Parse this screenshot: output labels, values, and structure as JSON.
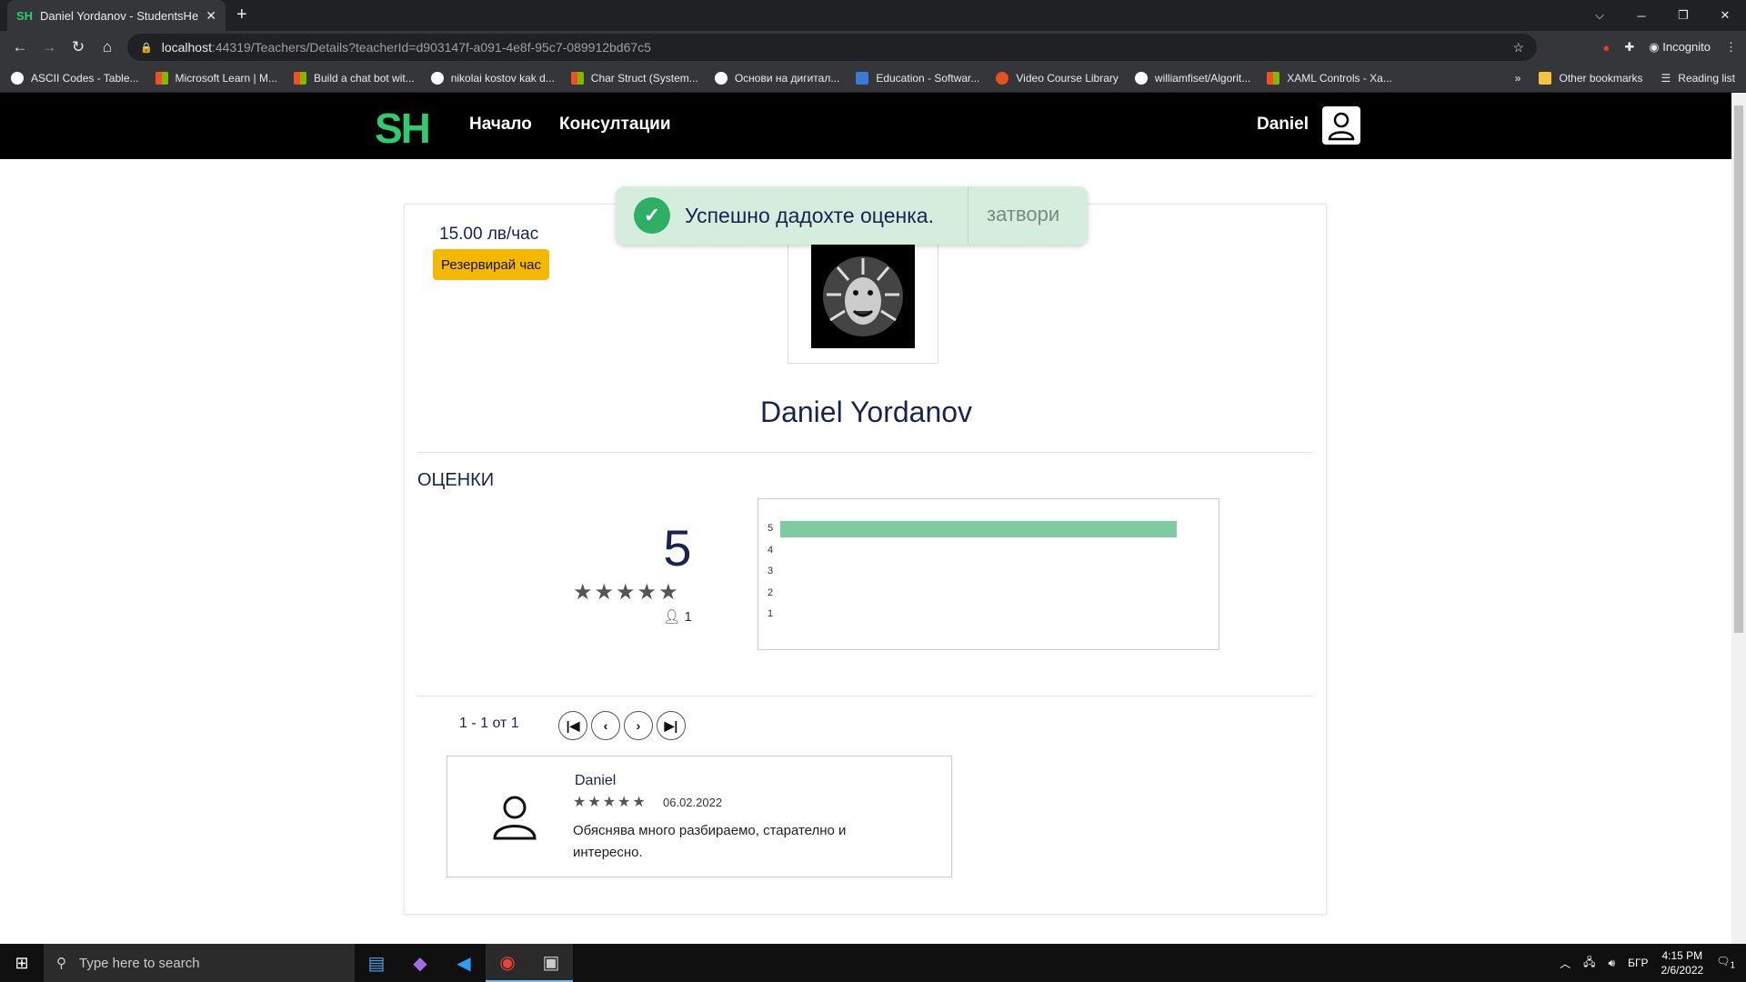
{
  "browser": {
    "tab_title": "Daniel Yordanov - StudentsHelpe",
    "tab_favicon": "SH",
    "url_host": "localhost",
    "url_rest": ":44319/Teachers/Details?teacherId=d903147f-a091-4e8f-95c7-089912bd67c5",
    "profile": "Incognito",
    "bookmarks": [
      {
        "label": "ASCII Codes - Table...",
        "color": "#ffffff"
      },
      {
        "label": "Microsoft Learn | M...",
        "color": "#f25022"
      },
      {
        "label": "Build a chat bot wit...",
        "color": "#f25022"
      },
      {
        "label": "nikolai kostov kak d...",
        "color": "#ffffff"
      },
      {
        "label": "Char Struct (System...",
        "color": "#f25022"
      },
      {
        "label": "Основи на дигитал...",
        "color": "#ffffff"
      },
      {
        "label": "Education - Softwar...",
        "color": "#3a7bd5"
      },
      {
        "label": "Video Course Library",
        "color": "#e8501c"
      },
      {
        "label": "williamfiset/Algorit...",
        "color": "#ffffff"
      },
      {
        "label": "XAML Controls - Xa...",
        "color": "#f25022"
      }
    ],
    "other_bookmarks": "Other bookmarks",
    "reading_list": "Reading list",
    "more": "»"
  },
  "site": {
    "logo": "SH",
    "nav": [
      "Начало",
      "Консултации"
    ],
    "user": "Daniel"
  },
  "toast": {
    "message": "Успешно дадохте оценка.",
    "close": "затвори"
  },
  "teacher": {
    "price": "15.00 лв/час",
    "reserve": "Резервирай час",
    "name": "Daniel Yordanov"
  },
  "ratings": {
    "label": "ОЦЕНКИ",
    "average": "5",
    "stars": 5,
    "count": "1"
  },
  "chart_data": {
    "type": "bar",
    "orientation": "horizontal",
    "categories": [
      "5",
      "4",
      "3",
      "2",
      "1"
    ],
    "values": [
      1,
      0,
      0,
      0,
      0
    ],
    "color": "#7ecba1"
  },
  "pagination": {
    "text": "1 - 1 от 1"
  },
  "reviews": [
    {
      "user": "Daniel",
      "stars": 5,
      "date": "06.02.2022",
      "text": "Обяснява много разбираемо, старателно и интересно."
    }
  ],
  "taskbar": {
    "search_placeholder": "Type here to search",
    "lang": "БГР",
    "time": "4:15 PM",
    "date": "2/6/2022",
    "notif_count": "1"
  }
}
